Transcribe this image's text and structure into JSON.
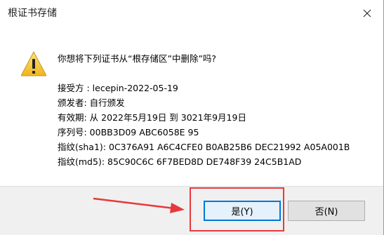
{
  "dialog": {
    "title": "根证书存储",
    "question": "你想将下列证书从“根存储区”中删除”吗?",
    "details": [
      "接受方 : lecepin-2022-05-19",
      "颁发者: 自行颁发",
      "有效期: 从 2022年5月19日 到 3021年9月19日",
      "序列号: 00BB3D09 ABC6058E 95",
      "指纹(sha1): 0C376A91 A6C4CFE0 B0AB25B6 DEC21992 A05A001B",
      "指纹(md5): 85C90C6C 6F7BED8D DE748F39 24C5B1AD"
    ],
    "yes_label": "是(Y)",
    "no_label": "否(N)"
  },
  "icons": {
    "warning": "warning-icon",
    "close": "close-icon",
    "annotation_arrow": "arrow-icon"
  },
  "colors": {
    "warning_fill": "#f5c22b",
    "annotation_red": "#e8383d",
    "focus_blue": "#0078d7",
    "footer_bg": "#f0f0f0"
  }
}
